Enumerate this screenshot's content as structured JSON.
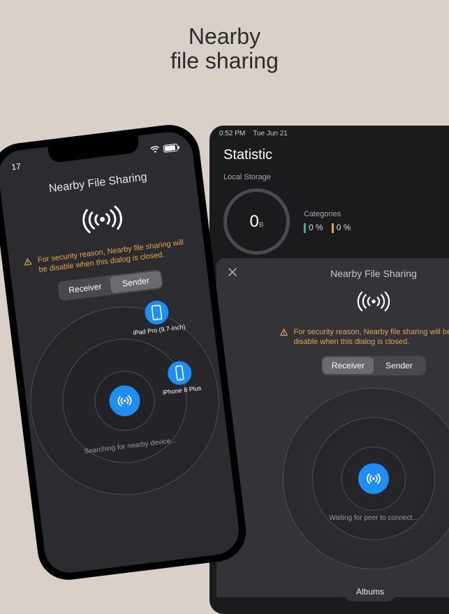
{
  "heading": {
    "line1": "Nearby",
    "line2": "file sharing"
  },
  "ipad": {
    "status_time": "0:52 PM",
    "status_date": "Tue Jun 21",
    "more_icon": "•••",
    "statistic_title": "Statistic",
    "local_storage_label": "Local Storage",
    "gauge_value": "0",
    "gauge_unit": "B",
    "categories_label": "Categories",
    "pct1": "0 %",
    "pct2": "0 %",
    "modal": {
      "title": "Nearby File Sharing",
      "warn": "For security reason, Nearby file sharing will be disable when this dialog is closed.",
      "seg_receiver": "Receiver",
      "seg_sender": "Sender",
      "active_tab": "receiver",
      "status": "Waiting for peer to connect..."
    },
    "albums_btn": "Albums"
  },
  "iphone": {
    "status_time": "17",
    "title": "Nearby File Sharing",
    "warn": "For security reason, Nearby file sharing will be disable when this dialog is closed.",
    "seg_receiver": "Receiver",
    "seg_sender": "Sender",
    "active_tab": "sender",
    "status": "Searching for nearby device...",
    "devices": [
      {
        "name": "iPad Pro (9.7-inch)"
      },
      {
        "name": "iPhone 8 Plus"
      }
    ]
  },
  "colors": {
    "accent": "#1e8ef5",
    "warn": "#e0a84a"
  }
}
